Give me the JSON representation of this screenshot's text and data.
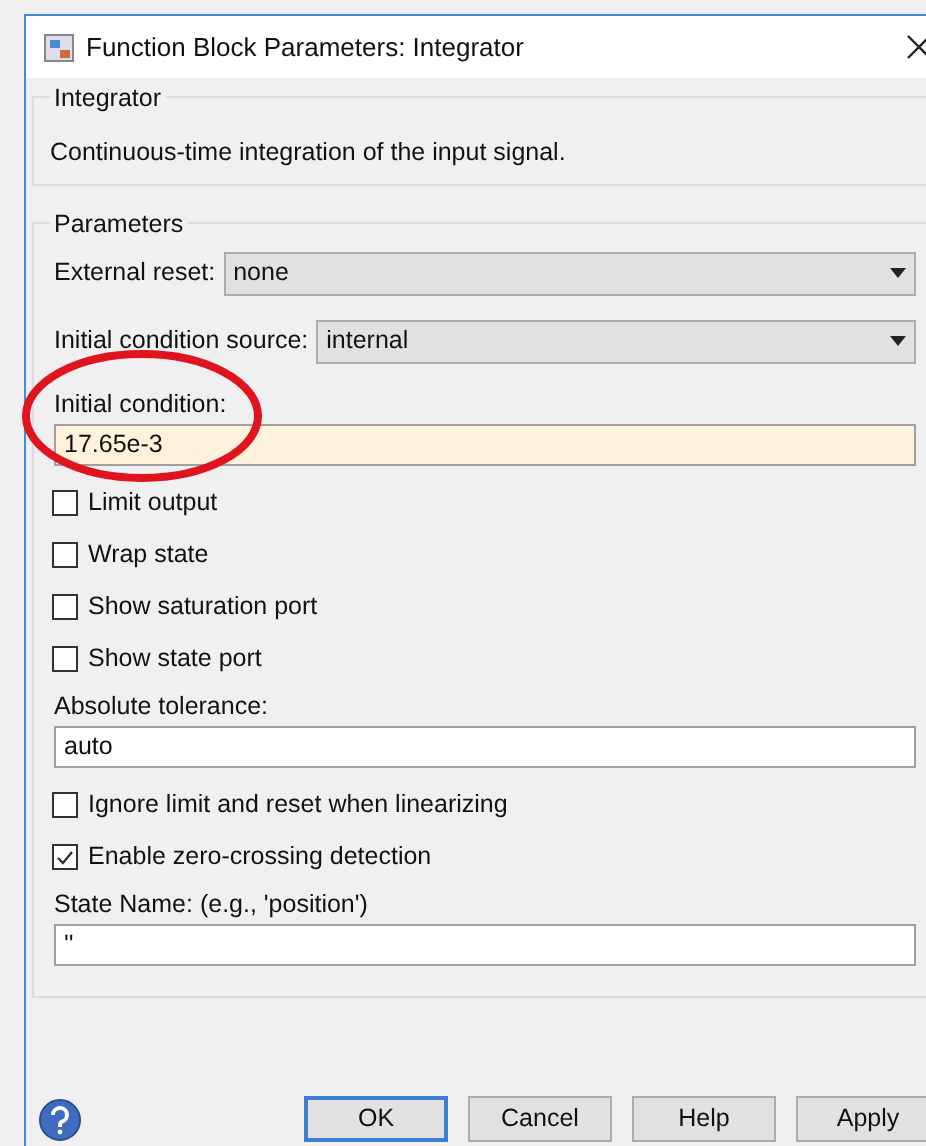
{
  "window": {
    "title": "Function Block Parameters: Integrator"
  },
  "description_group": {
    "title": "Integrator",
    "text": "Continuous-time integration of the input signal."
  },
  "parameters": {
    "title": "Parameters",
    "items": [
      {
        "kind": "dropdown",
        "label": "External reset:",
        "value": "none"
      },
      {
        "kind": "dropdown",
        "label": "Initial condition source:",
        "value": "internal"
      },
      {
        "kind": "field",
        "label": "Initial condition:",
        "value": "17.65e-3",
        "modified": true
      },
      {
        "kind": "checkbox",
        "label": "Limit output",
        "checked": false
      },
      {
        "kind": "checkbox",
        "label": "Wrap state",
        "checked": false
      },
      {
        "kind": "checkbox",
        "label": "Show saturation port",
        "checked": false
      },
      {
        "kind": "checkbox",
        "label": "Show state port",
        "checked": false
      },
      {
        "kind": "field",
        "label": "Absolute tolerance:",
        "value": "auto",
        "modified": false
      },
      {
        "kind": "checkbox",
        "label": "Ignore limit and reset when linearizing",
        "checked": false
      },
      {
        "kind": "checkbox",
        "label": "Enable zero-crossing detection",
        "checked": true
      },
      {
        "kind": "field",
        "label": "State Name: (e.g., 'position')",
        "value": "''",
        "modified": false
      }
    ]
  },
  "buttons": [
    {
      "label": "OK",
      "default": true
    },
    {
      "label": "Cancel",
      "default": false
    },
    {
      "label": "Help",
      "default": false
    },
    {
      "label": "Apply",
      "default": false
    }
  ]
}
